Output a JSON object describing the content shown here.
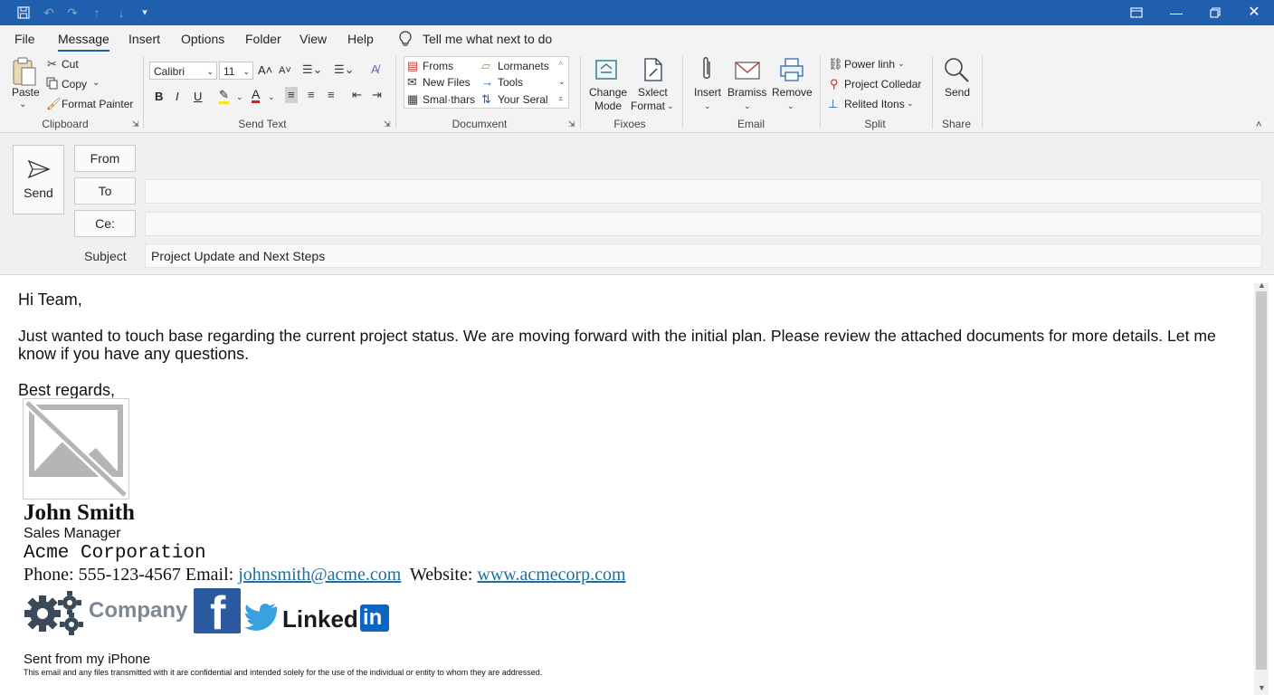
{
  "titlebar": {
    "icons": [
      "save-icon",
      "undo-icon",
      "redo-icon",
      "up-arrow-icon",
      "down-arrow-icon",
      "customize-icon"
    ],
    "window_controls": [
      "ribbon-display-icon",
      "minimize-icon",
      "restore-icon",
      "close-icon"
    ]
  },
  "menu": {
    "items": [
      "File",
      "Message",
      "Insert",
      "Options",
      "Folder",
      "View",
      "Help"
    ],
    "active": "Message",
    "tell_me": "Tell me what next to do"
  },
  "ribbon": {
    "clipboard": {
      "paste": "Paste",
      "cut": "Cut",
      "copy": "Copy",
      "format_painter": "Format Painter",
      "label": "Clipboard"
    },
    "text": {
      "font": "Calibri",
      "size": "11",
      "label": "Send Text"
    },
    "document": {
      "froms": "Froms",
      "new_files": "New Files",
      "smalthars": "Smal·thars",
      "lormanets": "Lormanets",
      "tools": "Tools",
      "your_seral": "Your Seral",
      "label": "Documxent"
    },
    "fixes": {
      "change_mode_1": "Change",
      "change_mode_2": "Mode",
      "select_format_1": "Sxlect",
      "select_format_2": "Format",
      "label": "Fixoes"
    },
    "email": {
      "insert": "Insert",
      "bramiss": "Bramiss",
      "remove": "Remove",
      "label": "Email"
    },
    "split": {
      "power_linh": "Power linh",
      "project_colledar": "Project Colledar",
      "relited_itons": "Relited Itons",
      "label": "Split"
    },
    "share": {
      "send": "Send",
      "label": "Share"
    }
  },
  "compose": {
    "send_label": "Send",
    "from_label": "From",
    "to_label": "To",
    "cc_label": "Ce:",
    "subject_label": "Subject",
    "to_value": "",
    "cc_value": "",
    "subject_value": "Project Update and Next Steps"
  },
  "body": {
    "greeting": "Hi Team,",
    "paragraph_line1": "Just wanted to touch base regarding the current project status. We are moving forward with the initial plan. Please review the attached documents for more details. Let me",
    "paragraph_line2": "know if you have any questions.",
    "closing": "Best regards,"
  },
  "signature": {
    "name": "John Smith",
    "title": "Sales Manager",
    "company": "Acme Corporation",
    "phone_label": "Phone:",
    "phone": "555-123-4567",
    "email_label": "Email:",
    "email": "johnsmith@acme.com",
    "website_label": "Website:",
    "website": "www.acmecorp.com",
    "company_logo_text": "Company",
    "facebook_letter": "f",
    "linkedin_text": "Linked",
    "linkedin_in": "in",
    "sent_from": "Sent from my iPhone",
    "disclaimer": "This email and any files transmitted with it are confidential and intended solely for the use of the individual or entity to whom they are addressed."
  },
  "colors": {
    "titlebar": "#1f5fae",
    "link": "#1f6f9e",
    "facebook": "#2b5aa0",
    "twitter": "#3aa1e0",
    "linkedin": "#0a66c2",
    "gear": "#3a4a58"
  }
}
